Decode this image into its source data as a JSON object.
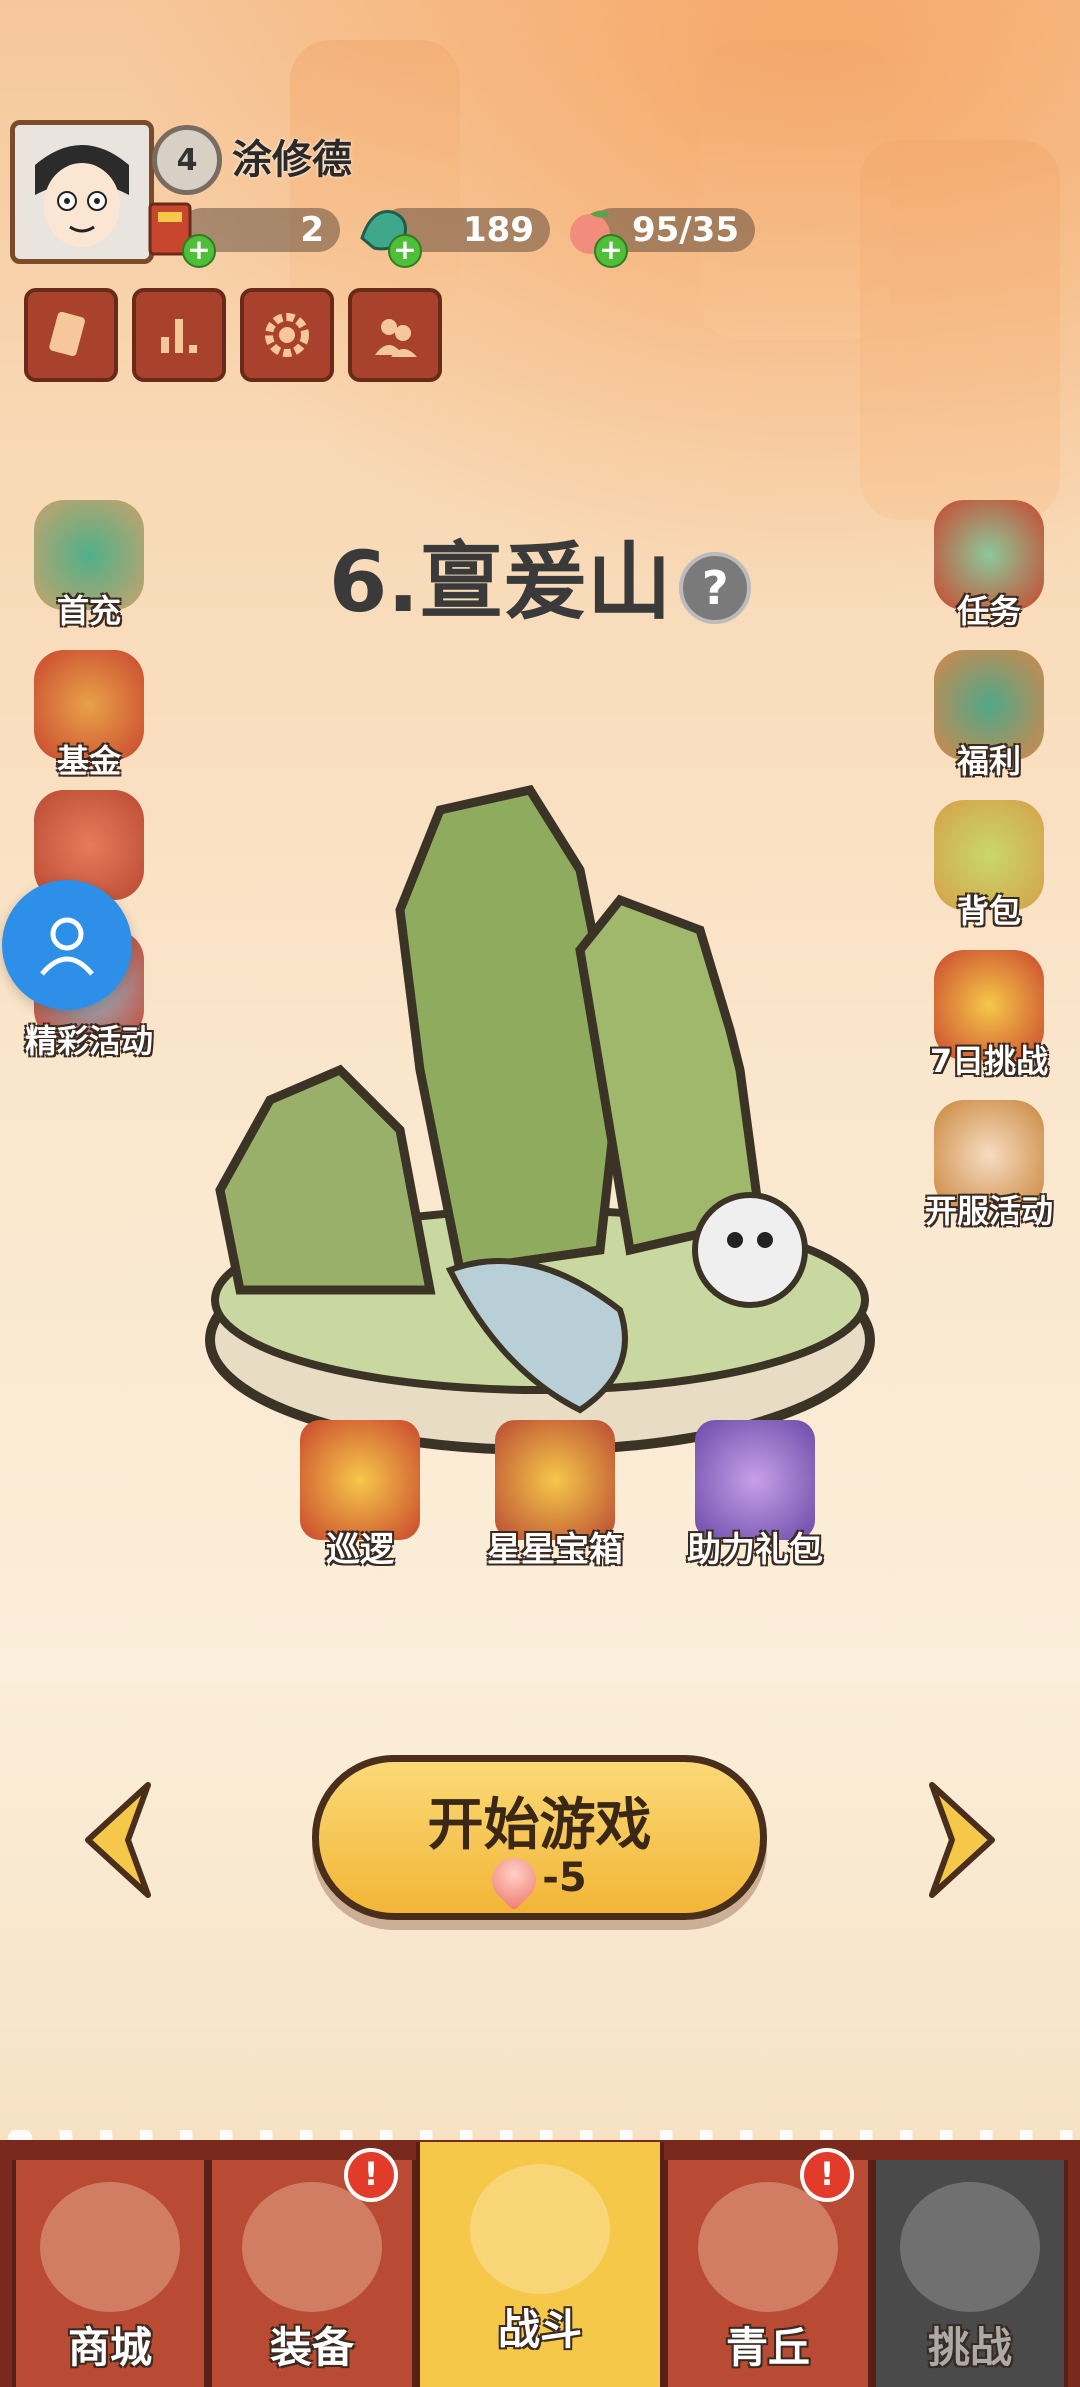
{
  "player": {
    "level": "4",
    "name": "涂修德"
  },
  "resources": [
    {
      "name": "ticket",
      "value": "2"
    },
    {
      "name": "jade",
      "value": "189"
    },
    {
      "name": "peach-stamina",
      "value": "95/35"
    }
  ],
  "menu_icons": [
    "card-icon",
    "stats-icon",
    "settings-gear-icon",
    "friends-icon"
  ],
  "left_buttons": [
    {
      "label": "首充",
      "icon": "jade-pile-icon"
    },
    {
      "label": "基金",
      "icon": "fund-scroll-icon"
    },
    {
      "label": "",
      "icon": "gift-bag-icon"
    },
    {
      "label": "精彩活动",
      "icon": "event-icon"
    }
  ],
  "right_buttons": [
    {
      "label": "任务",
      "icon": "scroll-icon"
    },
    {
      "label": "福利",
      "icon": "welfare-bag-icon"
    },
    {
      "label": "背包",
      "icon": "backpack-icon"
    },
    {
      "label": "7日挑战",
      "icon": "challenge-scroll-icon"
    },
    {
      "label": "开服活动",
      "icon": "server-event-icon"
    }
  ],
  "stage": {
    "title": "6.亶爰山",
    "help": "?"
  },
  "stage_items": [
    {
      "label": "巡逻",
      "icon": "patrol-flag-icon"
    },
    {
      "label": "星星宝箱",
      "icon": "star-chest-icon"
    },
    {
      "label": "助力礼包",
      "icon": "assist-gift-icon"
    }
  ],
  "start_button": {
    "label": "开始游戏",
    "cost": "-5"
  },
  "bottom_nav": [
    {
      "label": "商城",
      "state": "normal",
      "alert": ""
    },
    {
      "label": "装备",
      "state": "normal",
      "alert": "!"
    },
    {
      "label": "战斗",
      "state": "active",
      "alert": ""
    },
    {
      "label": "青丘",
      "state": "normal",
      "alert": "!"
    },
    {
      "label": "挑战",
      "state": "locked",
      "alert": ""
    }
  ],
  "colors": {
    "accent": "#f6c84a",
    "nav_bg": "#b94a33",
    "alert": "#e23b2a",
    "plus": "#4fbf3a"
  }
}
